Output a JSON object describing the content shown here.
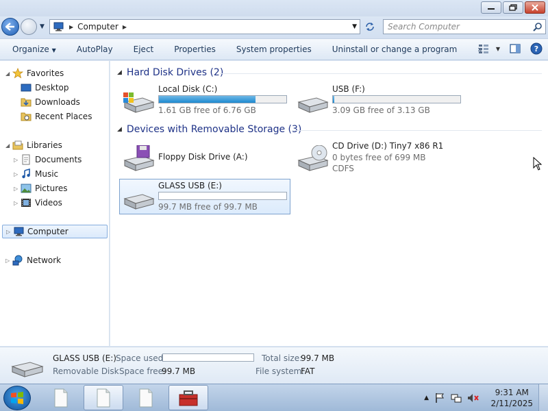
{
  "address": {
    "path_label": "Computer",
    "search_placeholder": "Search Computer"
  },
  "toolbar": {
    "items": [
      "Organize",
      "AutoPlay",
      "Eject",
      "Properties",
      "System properties",
      "Uninstall or change a program"
    ],
    "more": "»"
  },
  "sidebar": {
    "favorites": "Favorites",
    "desktop": "Desktop",
    "downloads": "Downloads",
    "recent": "Recent Places",
    "libraries": "Libraries",
    "documents": "Documents",
    "music": "Music",
    "pictures": "Pictures",
    "videos": "Videos",
    "computer": "Computer",
    "network": "Network"
  },
  "groups": {
    "hdd_title": "Hard Disk Drives (2)",
    "removable_title": "Devices with Removable Storage (3)"
  },
  "drives": {
    "local": {
      "name": "Local Disk (C:)",
      "free": "1.61 GB free of 6.76 GB",
      "used_fraction": 0.76
    },
    "usb": {
      "name": "USB (F:)",
      "free": "3.09 GB free of 3.13 GB",
      "used_fraction": 0.01
    },
    "floppy": {
      "name": "Floppy Disk Drive (A:)"
    },
    "cd": {
      "name": "CD Drive (D:) Tiny7 x86 R1",
      "free": "0 bytes free of 699 MB",
      "fs": "CDFS"
    },
    "glass": {
      "name": "GLASS USB (E:)",
      "free": "99.7 MB free of 99.7 MB",
      "used_fraction": 0.0
    }
  },
  "details": {
    "name": "GLASS USB (E:)",
    "type": "Removable Disk",
    "space_used_label": "Space used:",
    "space_free_label": "Space free:",
    "space_free": "99.7 MB",
    "total_size_label": "Total size:",
    "total_size": "99.7 MB",
    "file_system_label": "File system:",
    "file_system": "FAT"
  },
  "clock": {
    "time": "9:31 AM",
    "date": "2/11/2025"
  }
}
